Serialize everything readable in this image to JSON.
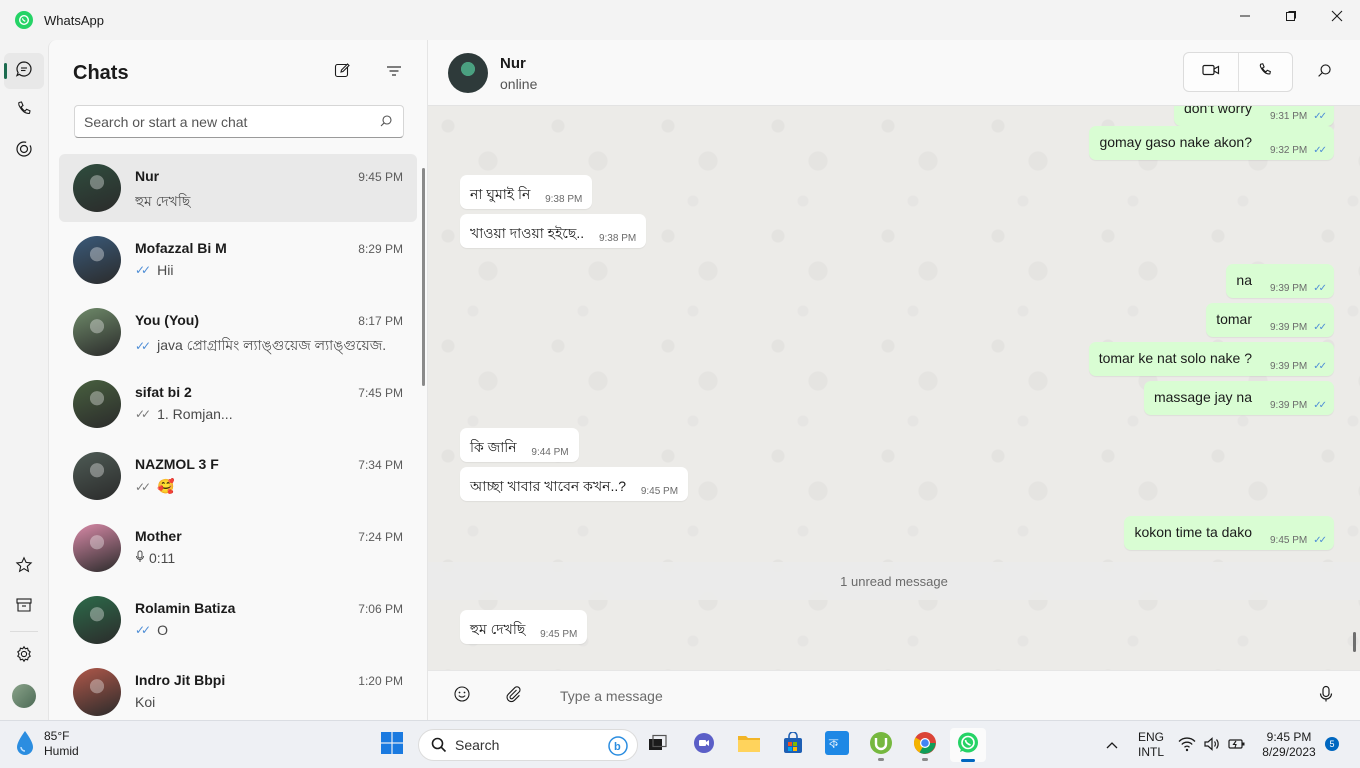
{
  "window": {
    "title": "WhatsApp"
  },
  "sidebar_rail": {
    "top_items": [
      {
        "name": "chats-icon"
      },
      {
        "name": "calls-icon"
      },
      {
        "name": "status-icon"
      }
    ],
    "bottom_items": [
      {
        "name": "starred-icon"
      },
      {
        "name": "archived-icon"
      },
      {
        "name": "settings-icon"
      }
    ]
  },
  "chat_list": {
    "title": "Chats",
    "search_placeholder": "Search or start a new chat",
    "chats": [
      {
        "name": "Nur",
        "time": "9:45 PM",
        "preview": "হুম দেখছি",
        "tick": "none",
        "active": true,
        "avatar_color": "#2f4d3e"
      },
      {
        "name": "Mofazzal Bi M",
        "time": "8:29 PM",
        "preview": "Hii",
        "tick": "blue",
        "active": false,
        "avatar_color": "#3a5a7a"
      },
      {
        "name": "You (You)",
        "time": "8:17 PM",
        "preview": "java প্রোগ্রামিং ল্যাঙ্গুয়েজ ল্যাঙ্গুয়েজ...",
        "tick": "blue",
        "active": false,
        "avatar_color": "#6f8b6a"
      },
      {
        "name": "sifat bi 2",
        "time": "7:45 PM",
        "preview": "1. Romjan...",
        "tick": "grey",
        "active": false,
        "avatar_color": "#48603f"
      },
      {
        "name": "NAZMOL 3 F",
        "time": "7:34 PM",
        "preview": "🥰",
        "tick": "grey",
        "active": false,
        "avatar_color": "#4e5b55"
      },
      {
        "name": "Mother",
        "time": "7:24 PM",
        "preview": "0:11",
        "tick": "mic",
        "active": false,
        "avatar_color": "#d98aa8"
      },
      {
        "name": "Rolamin Batiza",
        "time": "7:06 PM",
        "preview": "O",
        "tick": "blue",
        "active": false,
        "avatar_color": "#2d6b4a"
      },
      {
        "name": "Indro Jit Bbpi",
        "time": "1:20 PM",
        "preview": "Koi",
        "tick": "none",
        "active": false,
        "avatar_color": "#b0584a"
      }
    ]
  },
  "conversation": {
    "contact_name": "Nur",
    "contact_status": "online",
    "unread_label": "1 unread message",
    "messages": [
      {
        "text": "don't worry",
        "time": "9:31 PM",
        "direction": "out",
        "read": true
      },
      {
        "text": "gomay gaso nake akon?",
        "time": "9:32 PM",
        "direction": "out",
        "read": true
      },
      {
        "text": "না ঘুমাই নি",
        "time": "9:38 PM",
        "direction": "in",
        "read": false
      },
      {
        "text": "খাওয়া দাওয়া হইছে..",
        "time": "9:38 PM",
        "direction": "in",
        "read": false
      },
      {
        "text": "na",
        "time": "9:39 PM",
        "direction": "out",
        "read": true
      },
      {
        "text": "tomar",
        "time": "9:39 PM",
        "direction": "out",
        "read": true
      },
      {
        "text": "tomar ke nat solo nake ?",
        "time": "9:39 PM",
        "direction": "out",
        "read": true
      },
      {
        "text": "massage jay na",
        "time": "9:39 PM",
        "direction": "out",
        "read": true
      },
      {
        "text": "কি জানি",
        "time": "9:44 PM",
        "direction": "in",
        "read": false
      },
      {
        "text": "আচ্ছা খাবার খাবেন কখন..?",
        "time": "9:45 PM",
        "direction": "in",
        "read": false
      },
      {
        "text": "kokon time ta dako",
        "time": "9:45 PM",
        "direction": "out",
        "read": true
      },
      {
        "text": "হুম দেখছি",
        "time": "9:45 PM",
        "direction": "in",
        "read": false
      }
    ],
    "composer_placeholder": "Type a message"
  },
  "taskbar": {
    "weather_temp": "85°F",
    "weather_desc": "Humid",
    "search_label": "Search",
    "lang_line1": "ENG",
    "lang_line2": "INTL",
    "clock_time": "9:45 PM",
    "clock_date": "8/29/2023",
    "notification_count": "5"
  }
}
